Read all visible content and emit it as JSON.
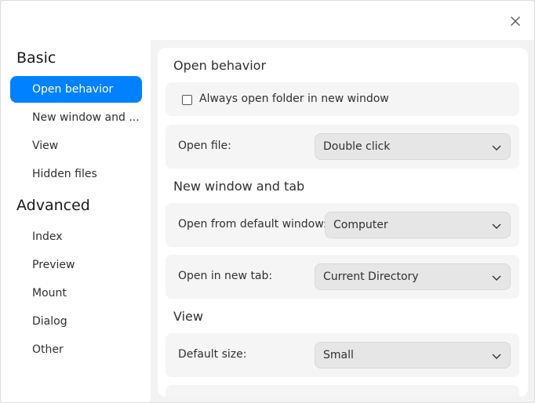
{
  "sidebar": {
    "groups": [
      {
        "label": "Basic",
        "items": [
          "Open behavior",
          "New window and ...",
          "View",
          "Hidden files"
        ]
      },
      {
        "label": "Advanced",
        "items": [
          "Index",
          "Preview",
          "Mount",
          "Dialog",
          "Other"
        ]
      }
    ],
    "active_item": "Open behavior"
  },
  "main": {
    "open_behavior": {
      "title": "Open behavior",
      "checkbox_label": "Always open folder in new window",
      "checkbox_checked": false,
      "open_file_label": "Open file:",
      "open_file_value": "Double click"
    },
    "new_window": {
      "title": "New window and tab",
      "default_window_label": "Open from default window:",
      "default_window_value": "Computer",
      "new_tab_label": "Open in new tab:",
      "new_tab_value": "Current Directory"
    },
    "view": {
      "title": "View",
      "default_size_label": "Default size:",
      "default_size_value": "Small"
    }
  },
  "icons": {
    "close": "close-icon",
    "dropdown": "chevron-down-icon"
  },
  "colors": {
    "accent": "#0081ff",
    "card_bg": "#f5f5f5",
    "combo_bg": "#e6e6e6"
  }
}
